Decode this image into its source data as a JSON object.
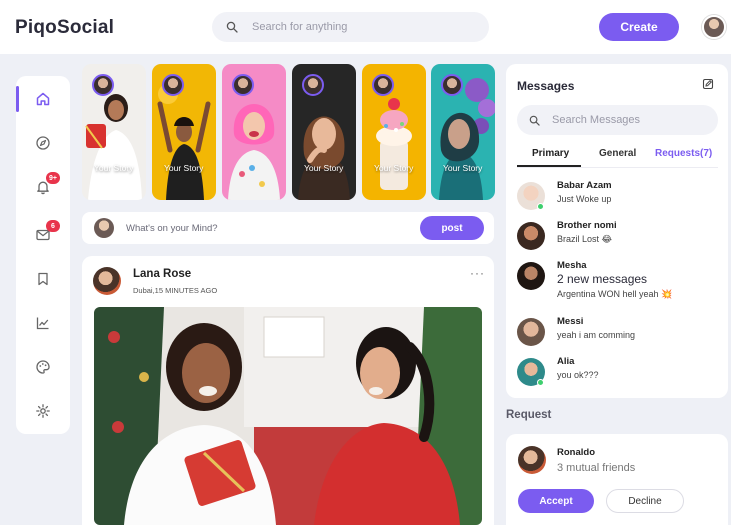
{
  "app": {
    "logo": "PiqoSocial"
  },
  "header": {
    "search_placeholder": "Search for anything",
    "create_label": "Create"
  },
  "nav": {
    "items": [
      {
        "icon": "home-icon",
        "active": true
      },
      {
        "icon": "compass-icon"
      },
      {
        "icon": "notification-icon",
        "badge": "9+"
      },
      {
        "icon": "mail-icon",
        "badge": "6"
      },
      {
        "icon": "bookmark-icon"
      },
      {
        "icon": "analytics-icon"
      },
      {
        "icon": "palette-icon"
      },
      {
        "icon": "settings-icon"
      }
    ]
  },
  "stories": [
    {
      "label": "Your Story",
      "bg": "#f3f1ef"
    },
    {
      "label": "Your Story",
      "bg": "#f2b705"
    },
    {
      "label": "",
      "bg": "#f58bc6"
    },
    {
      "label": "Your Story",
      "bg": "#2a2a2a"
    },
    {
      "label": "Your Story",
      "bg": "#f4b400"
    },
    {
      "label": "Your Story",
      "bg": "#2bb3b1"
    }
  ],
  "composer": {
    "placeholder": "What's on your Mind?",
    "post_label": "post"
  },
  "feed": {
    "author": "Lana Rose",
    "meta": "Dubai,15 MINUTES AGO",
    "more": "···"
  },
  "messages": {
    "title": "Messages",
    "search_placeholder": "Search Messages",
    "tabs": {
      "primary": "Primary",
      "general": "General",
      "requests": "Requests(7)"
    },
    "list": [
      {
        "name": "Babar Azam",
        "text": "Just Woke up",
        "online": true
      },
      {
        "name": "Brother nomi",
        "text": "Brazil Lost 😂",
        "online": false
      },
      {
        "name": "Mesha",
        "big": "2 new messages",
        "text": "Argentina WON hell yeah 💥",
        "online": false
      },
      {
        "name": "Messi",
        "text": "yeah i am comming",
        "online": false
      },
      {
        "name": "Alia",
        "text": "you ok???",
        "online": true
      }
    ]
  },
  "request": {
    "title": "Request",
    "name": "Ronaldo",
    "mutual": "3 mutual friends",
    "accept_label": "Accept",
    "decline_label": "Decline"
  },
  "colors": {
    "accent": "#7b5cf0",
    "badge": "#e8344b",
    "online": "#3ecf6e"
  }
}
